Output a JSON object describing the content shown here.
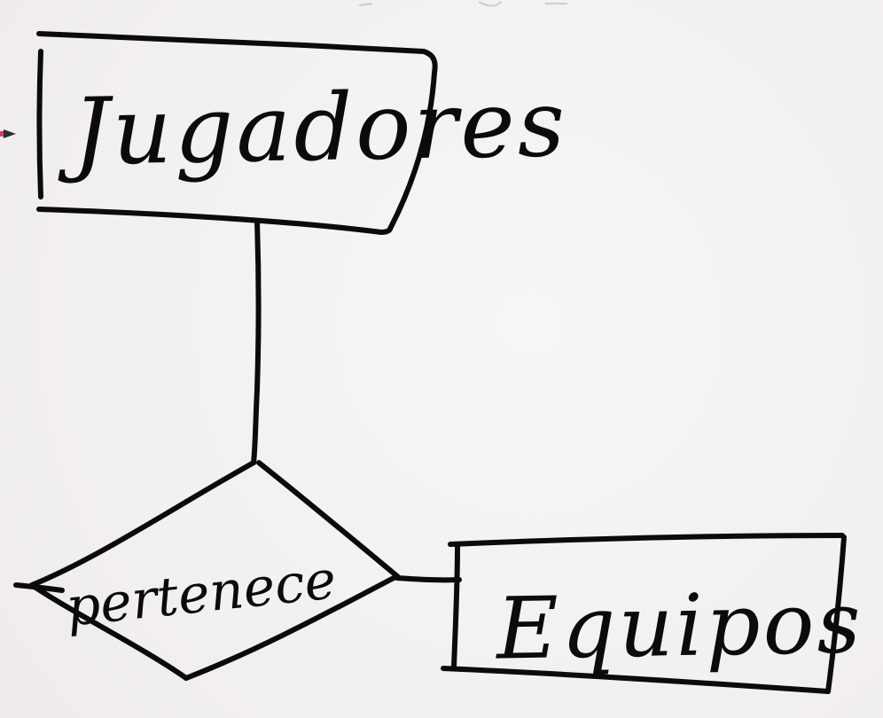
{
  "diagram": {
    "entities": [
      {
        "id": "jugadores",
        "label": "Jugadores"
      },
      {
        "id": "equipos",
        "label": "Equipos"
      }
    ],
    "relationship": {
      "id": "pertenece",
      "label": "pertenece"
    },
    "edges": [
      {
        "from": "jugadores",
        "to": "pertenece"
      },
      {
        "from": "pertenece",
        "to": "equipos"
      }
    ]
  },
  "colors": {
    "ink": "#0b0b0b",
    "background": "#f4f1f3",
    "pen_cursor": "#d6405f"
  },
  "icons": {
    "cursor": "pen-cursor-icon"
  }
}
